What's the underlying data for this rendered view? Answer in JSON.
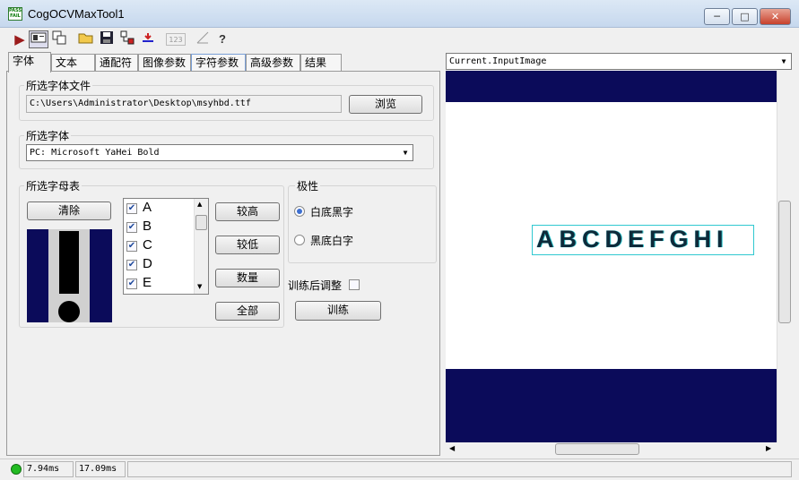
{
  "window": {
    "title": "CogOCVMaxTool1",
    "icon_text": "PASS FAIL"
  },
  "window_controls": {
    "minimize": "─",
    "maximize": "□",
    "close": "✕"
  },
  "toolbar": {
    "icons": [
      "run-icon",
      "live-display-icon",
      "reset-icon",
      "open-icon",
      "save-icon",
      "tree-icon",
      "undo-icon",
      "counter-icon",
      "measure-icon",
      "help-icon"
    ],
    "counter_label": "123",
    "help_label": "?"
  },
  "tabs": [
    {
      "label": "字体",
      "active": true
    },
    {
      "label": "文本",
      "active": false
    },
    {
      "label": "通配符",
      "active": false
    },
    {
      "label": "图像参数",
      "active": false
    },
    {
      "label": "字符参数",
      "active": false
    },
    {
      "label": "高级参数",
      "active": false
    },
    {
      "label": "结果",
      "active": false
    }
  ],
  "font_file": {
    "title": "所选字体文件",
    "path": "C:\\Users\\Administrator\\Desktop\\msyhbd.ttf",
    "browse_label": "浏览"
  },
  "font": {
    "title": "所选字体",
    "value": "PC: Microsoft YaHei Bold"
  },
  "alphabet": {
    "title": "所选字母表",
    "clear_label": "清除",
    "chars": [
      {
        "label": "A",
        "checked": true
      },
      {
        "label": "B",
        "checked": true
      },
      {
        "label": "C",
        "checked": true
      },
      {
        "label": "D",
        "checked": true
      },
      {
        "label": "E",
        "checked": true
      }
    ],
    "btn_higher": "较高",
    "btn_lower": "较低",
    "btn_digits": "数量",
    "btn_all": "全部"
  },
  "polarity": {
    "title": "极性",
    "options": [
      {
        "label": "白底黑字",
        "selected": true
      },
      {
        "label": "黑底白字",
        "selected": false
      }
    ]
  },
  "train": {
    "adjust_label": "训练后调整",
    "adjust_checked": false,
    "train_label": "训练"
  },
  "image": {
    "selector": "Current.InputImage",
    "sample_text": "ABCDEFGHI",
    "colors": {
      "band": "#0b0b5a",
      "glyph": "#0e2a3a",
      "outline": "#30c8d0"
    }
  },
  "status": {
    "time1": "7.94ms",
    "time2": "17.09ms",
    "indicator": "#22bb22"
  }
}
